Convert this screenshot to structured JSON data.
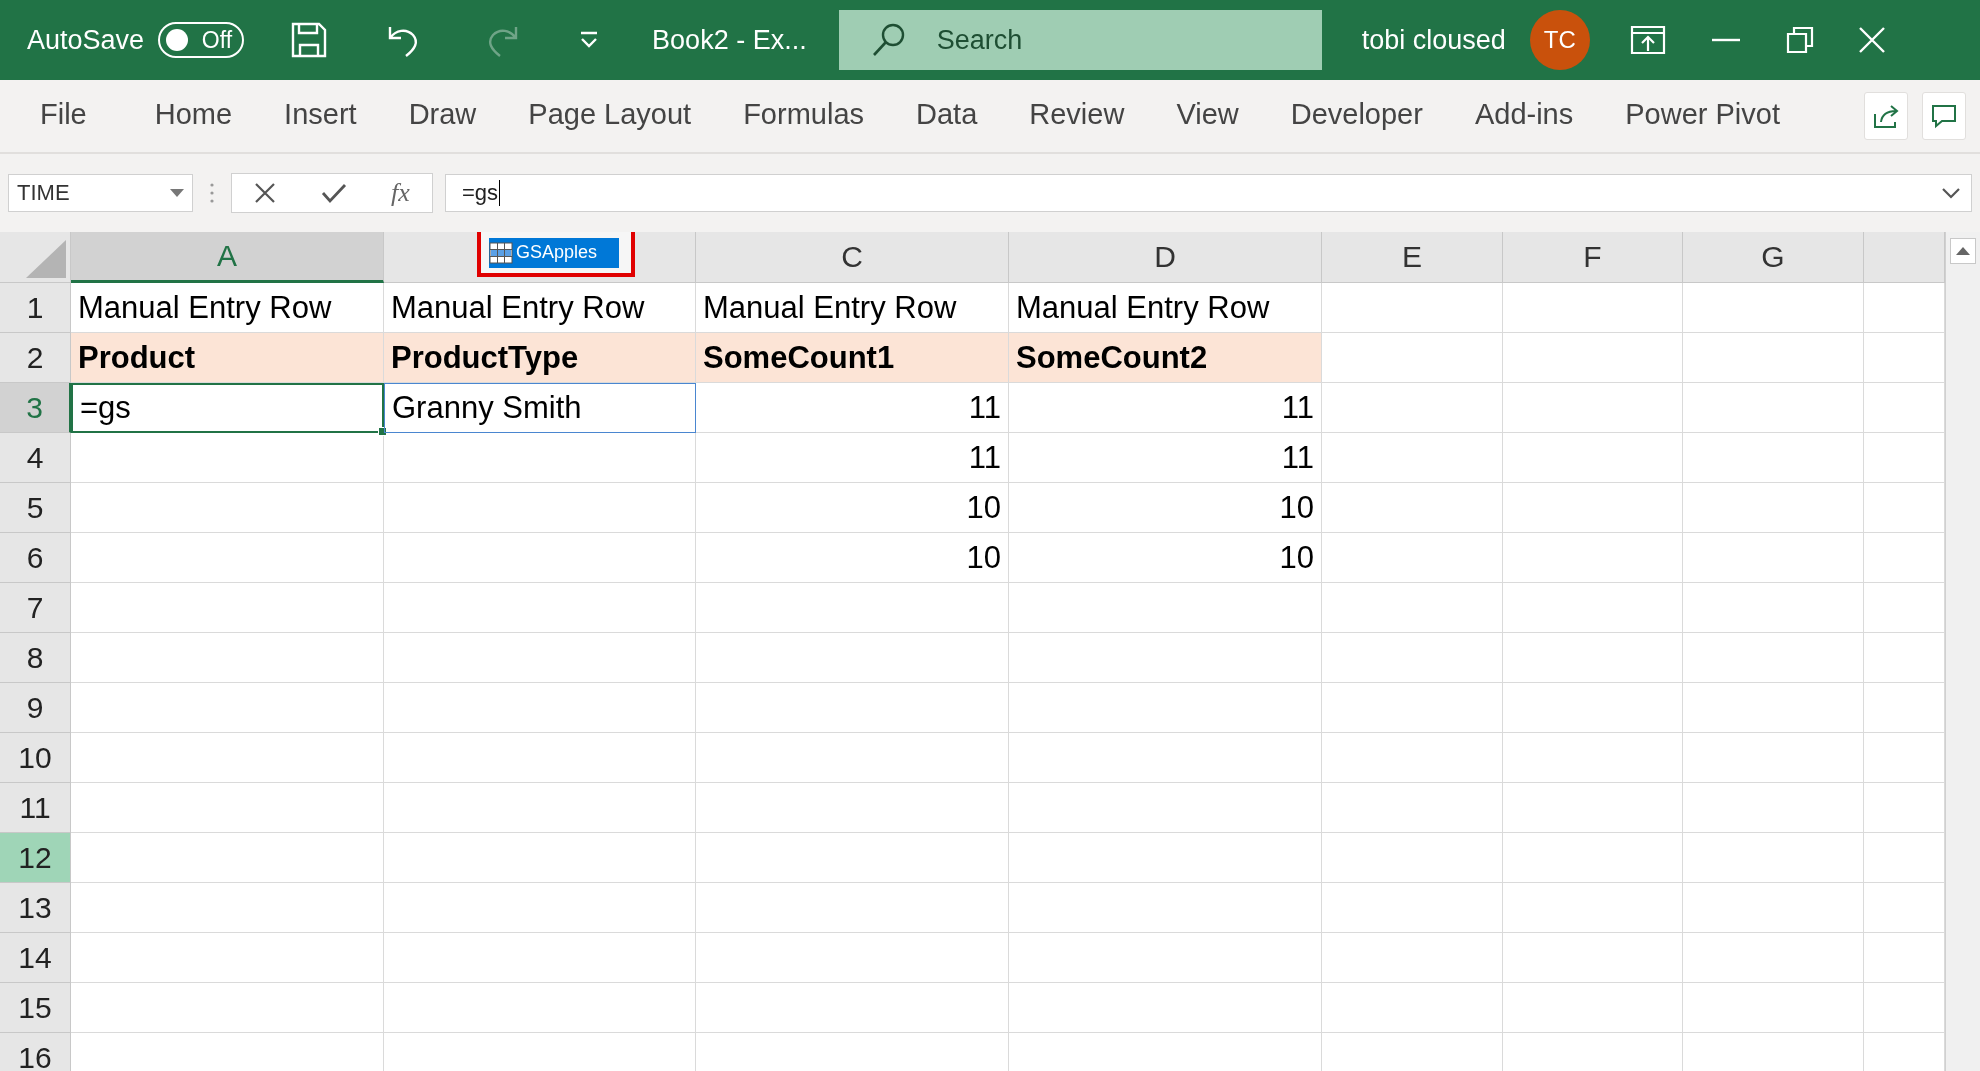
{
  "title_bar": {
    "autosave": {
      "label": "AutoSave",
      "state_label": "Off",
      "on": false
    },
    "redo_enabled": false,
    "document_title": "Book2  -  Ex...",
    "search": {
      "placeholder": "Search"
    },
    "user_name": "tobi cloused",
    "avatar_initials": "TC"
  },
  "ribbon_tabs": [
    {
      "label": "File",
      "selected": false
    },
    {
      "label": "Home",
      "selected": false
    },
    {
      "label": "Insert",
      "selected": false
    },
    {
      "label": "Draw",
      "selected": false
    },
    {
      "label": "Page Layout",
      "selected": false
    },
    {
      "label": "Formulas",
      "selected": false
    },
    {
      "label": "Data",
      "selected": false
    },
    {
      "label": "Review",
      "selected": false
    },
    {
      "label": "View",
      "selected": false
    },
    {
      "label": "Developer",
      "selected": false
    },
    {
      "label": "Add-ins",
      "selected": false
    },
    {
      "label": "Power Pivot",
      "selected": false
    }
  ],
  "formula_bar": {
    "name_box": "TIME",
    "function_label": "fx",
    "value": "=gs"
  },
  "autocomplete": {
    "marked": true,
    "items": [
      {
        "label": "GSApples",
        "selected": true
      }
    ]
  },
  "columns": [
    {
      "label": "A",
      "selected": true
    },
    {
      "selected": false
    },
    {
      "label": "C",
      "selected": false
    },
    {
      "label": "D",
      "selected": false
    },
    {
      "label": "E",
      "selected": false
    },
    {
      "label": "F",
      "selected": false
    },
    {
      "label": "G",
      "selected": false
    },
    {
      "selected": false
    }
  ],
  "rows": [
    {
      "number": "1",
      "selected": false,
      "highlighted": false,
      "cells": [
        {
          "kind": "text",
          "text": "Manual Entry Row"
        },
        {
          "kind": "text",
          "text": "Manual Entry Row"
        },
        {
          "kind": "text",
          "text": "Manual Entry Row"
        },
        {
          "kind": "text",
          "text": "Manual Entry Row"
        }
      ]
    },
    {
      "number": "2",
      "selected": false,
      "highlighted": false,
      "cells": [
        {
          "kind": "heading",
          "text": "Product"
        },
        {
          "kind": "heading",
          "text": "ProductType"
        },
        {
          "kind": "heading",
          "text": "SomeCount1"
        },
        {
          "kind": "heading",
          "text": "SomeCount2"
        }
      ]
    },
    {
      "number": "3",
      "selected": true,
      "highlighted": false,
      "cells": [
        {
          "kind": "editing",
          "text": "=gs"
        },
        {
          "kind": "referenced",
          "text": "Granny Smith"
        },
        {
          "kind": "number",
          "text": "11"
        },
        {
          "kind": "number",
          "text": "11"
        }
      ]
    },
    {
      "number": "4",
      "selected": false,
      "highlighted": false,
      "cells": [
        {
          "kind": "empty"
        },
        {
          "kind": "empty"
        },
        {
          "kind": "number",
          "text": "11"
        },
        {
          "kind": "number",
          "text": "11"
        }
      ]
    },
    {
      "number": "5",
      "selected": false,
      "highlighted": false,
      "cells": [
        {
          "kind": "empty"
        },
        {
          "kind": "empty"
        },
        {
          "kind": "number",
          "text": "10"
        },
        {
          "kind": "number",
          "text": "10"
        }
      ]
    },
    {
      "number": "6",
      "selected": false,
      "highlighted": false,
      "cells": [
        {
          "kind": "empty"
        },
        {
          "kind": "empty"
        },
        {
          "kind": "number",
          "text": "10"
        },
        {
          "kind": "number",
          "text": "10"
        }
      ]
    },
    {
      "number": "7",
      "selected": false,
      "highlighted": false
    },
    {
      "number": "8",
      "selected": false,
      "highlighted": false
    },
    {
      "number": "9",
      "selected": false,
      "highlighted": false
    },
    {
      "number": "10",
      "selected": false,
      "highlighted": false
    },
    {
      "number": "11",
      "selected": false,
      "highlighted": false
    },
    {
      "number": "12",
      "selected": false,
      "highlighted": true
    },
    {
      "number": "13",
      "selected": false,
      "highlighted": false
    },
    {
      "number": "14",
      "selected": false,
      "highlighted": false
    },
    {
      "number": "15",
      "selected": false,
      "highlighted": false
    },
    {
      "number": "16",
      "selected": false,
      "highlighted": false
    }
  ]
}
